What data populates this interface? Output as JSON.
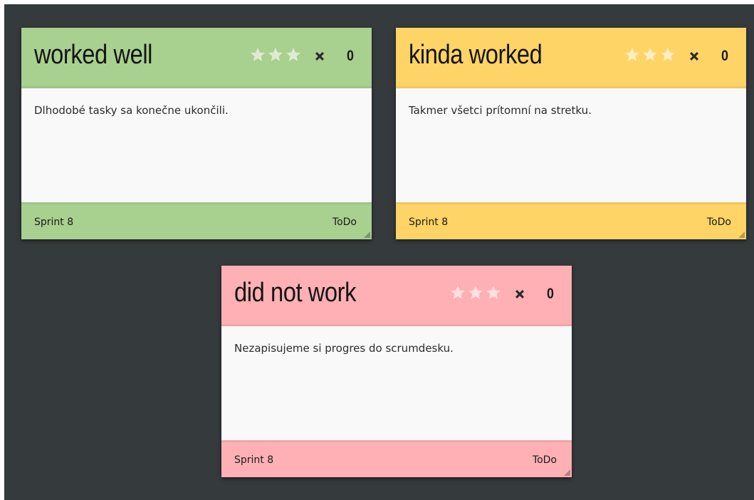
{
  "colors": {
    "board_background": "#353a3d",
    "card_body": "#f9f9f9",
    "star_color": "#fffdfb",
    "icon_color": "#2a2a2a"
  },
  "cards": [
    {
      "title": "worked well",
      "text": "Dlhodobé tasky sa konečne ukončili.",
      "votes": "0",
      "sprint": "Sprint 8",
      "status": "ToDo",
      "stars": 3,
      "header_color": "#a8d08f",
      "footer_color": "#a8d08f"
    },
    {
      "title": "kinda worked",
      "text": "Takmer všetci prítomní na stretku.",
      "votes": "0",
      "sprint": "Sprint 8",
      "status": "ToDo",
      "stars": 3,
      "header_color": "#ffd466",
      "footer_color": "#ffd466"
    },
    {
      "title": "did not work",
      "text": "Nezapisujeme si progres do scrumdesku.",
      "votes": "0",
      "sprint": "Sprint 8",
      "status": "ToDo",
      "stars": 3,
      "header_color": "#ffb0b4",
      "footer_color": "#ffb0b4"
    }
  ],
  "icons": {
    "star": "star-icon",
    "delete": "close-icon",
    "resize": "resize-handle-icon"
  }
}
